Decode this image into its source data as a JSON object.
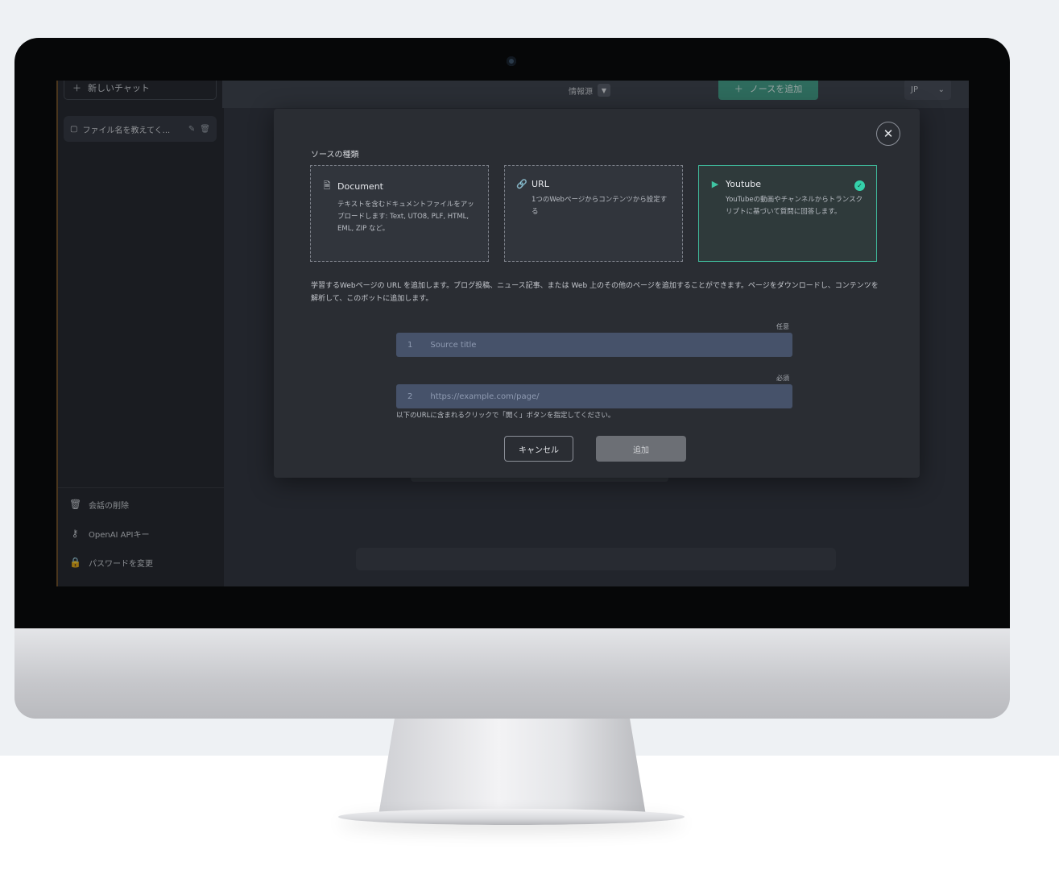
{
  "sidebar": {
    "new_chat_label": "新しいチャット",
    "chat_item_label": "ファイル名を教えてく...",
    "links": [
      {
        "icon": "trash-icon",
        "label": "会話の削除"
      },
      {
        "icon": "key-icon",
        "label": "OpenAI APIキー"
      },
      {
        "icon": "lock-icon",
        "label": "パスワードを変更"
      }
    ]
  },
  "topbar": {
    "role_label": "情報源",
    "add_knowledge_label": "ノースを追加",
    "language": "JP"
  },
  "modal": {
    "title": "ソースの種類",
    "cards": [
      {
        "icon": "document-icon",
        "title": "Document",
        "description": "テキストを含むドキュメントファイルをアップロードします: Text, UTO8, PLF, HTML, EML, ZIP など。",
        "selected": false
      },
      {
        "icon": "link-icon",
        "title": "URL",
        "description": "1つのWebページからコンテンツから設定する",
        "selected": false
      },
      {
        "icon": "youtube-icon",
        "title": "Youtube",
        "description": "YouTubeの動画やチャンネルからトランスクリプトに基づいて質問に回答します。",
        "selected": true
      }
    ],
    "description": "学習するWebページの URL を追加します。ブログ投稿、ニュース記事、または Web 上のその他のページを追加することができます。ページをダウンロードし、コンテンツを解析して、このボットに追加します。",
    "fields": [
      {
        "index": "1",
        "tag": "任意",
        "placeholder": "Source title"
      },
      {
        "index": "2",
        "tag": "必須",
        "placeholder": "https://example.com/page/"
      }
    ],
    "help_text": "以下のURLに含まれるクリックで「開く」ボタンを指定してください。",
    "cancel_label": "キャンセル",
    "add_label": "追加"
  }
}
